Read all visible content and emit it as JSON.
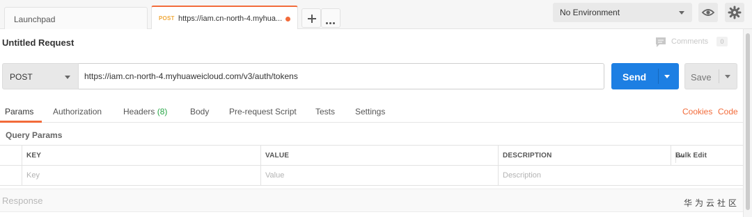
{
  "tabs": [
    {
      "label": "Launchpad"
    },
    {
      "method": "POST",
      "url": "https://iam.cn-north-4.myhua..."
    }
  ],
  "environment": {
    "selected": "No Environment"
  },
  "request": {
    "title": "Untitled Request",
    "comments_label": "Comments",
    "comments_count": "0",
    "method": "POST",
    "url": "https://iam.cn-north-4.myhuaweicloud.com/v3/auth/tokens",
    "send_label": "Send",
    "save_label": "Save"
  },
  "subtabs": {
    "params": "Params",
    "authorization": "Authorization",
    "headers": "Headers",
    "headers_count": "(8)",
    "body": "Body",
    "prerequest": "Pre-request Script",
    "tests": "Tests",
    "settings": "Settings",
    "cookies": "Cookies",
    "code": "Code"
  },
  "query_params": {
    "title": "Query Params",
    "columns": [
      "KEY",
      "VALUE",
      "DESCRIPTION"
    ],
    "bulk_edit": "Bulk Edit",
    "placeholders": {
      "key": "Key",
      "value": "Value",
      "description": "Description"
    }
  },
  "response": {
    "label": "Response"
  },
  "watermark": "华为云社区",
  "colors": {
    "accent": "#f26b3a",
    "send": "#1d7fe3",
    "headers_count": "#26a545",
    "method_tab": "#f0a93b"
  },
  "icons": [
    "plus-icon",
    "more-icon",
    "eye-icon",
    "gear-icon",
    "comment-icon",
    "caret-down-icon"
  ]
}
